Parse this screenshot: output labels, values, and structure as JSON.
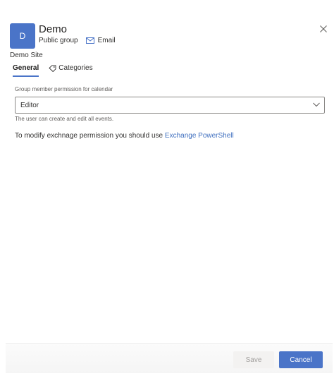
{
  "header": {
    "avatar_initial": "D",
    "title": "Demo",
    "group_type": "Public group",
    "email_label": "Email",
    "site_name": "Demo Site"
  },
  "tabs": [
    {
      "label": "General",
      "active": true
    },
    {
      "label": "Categories",
      "active": false
    }
  ],
  "calendar_permission": {
    "label": "Group member permission for calendar",
    "selected": "Editor",
    "helper": "The user can create and edit all events."
  },
  "exchange_note": {
    "text": "To modify exchnage permission you should use ",
    "link": "Exchange PowerShell"
  },
  "footer": {
    "save_label": "Save",
    "cancel_label": "Cancel"
  },
  "colors": {
    "accent": "#4a74c8",
    "link": "#3f6fbf",
    "disabled_bg": "#f3f2f1",
    "disabled_text": "#a19f9d"
  },
  "icons": {
    "close": "close-icon",
    "mail": "mail-icon",
    "tag": "tag-icon",
    "chevron": "chevron-down-icon"
  }
}
